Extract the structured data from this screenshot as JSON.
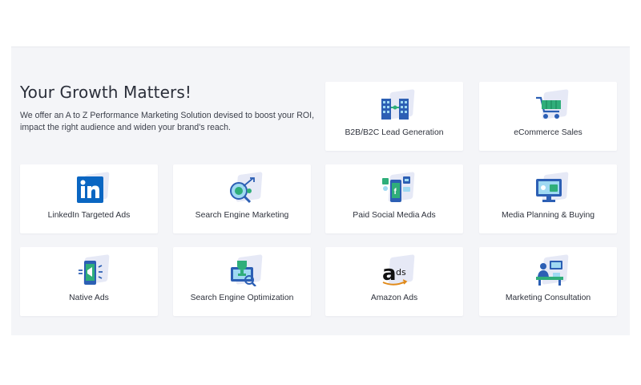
{
  "intro": {
    "title": "Your Growth Matters!",
    "description": "We offer an A to Z Performance Marketing Solution devised to boost your ROI, impact the right audience and widen your brand's reach."
  },
  "services": [
    {
      "label": "B2B/B2C Lead Generation",
      "icon": "buildings-icon"
    },
    {
      "label": "eCommerce Sales",
      "icon": "shopping-cart-icon"
    },
    {
      "label": "LinkedIn Targeted Ads",
      "icon": "linkedin-icon"
    },
    {
      "label": "Search Engine Marketing",
      "icon": "search-target-icon"
    },
    {
      "label": "Paid Social Media Ads",
      "icon": "social-media-phone-icon"
    },
    {
      "label": "Media Planning & Buying",
      "icon": "monitor-media-icon"
    },
    {
      "label": "Native Ads",
      "icon": "native-ads-phone-icon"
    },
    {
      "label": "Search Engine Optimization",
      "icon": "seo-trophy-icon"
    },
    {
      "label": "Amazon Ads",
      "icon": "amazon-ads-icon"
    },
    {
      "label": "Marketing Consultation",
      "icon": "consultation-desk-icon"
    }
  ],
  "colors": {
    "accent_blue": "#2c5fb4",
    "accent_green": "#2fae7a",
    "linkedin_blue": "#0a66c2",
    "panel_bg": "#f4f5f8"
  }
}
